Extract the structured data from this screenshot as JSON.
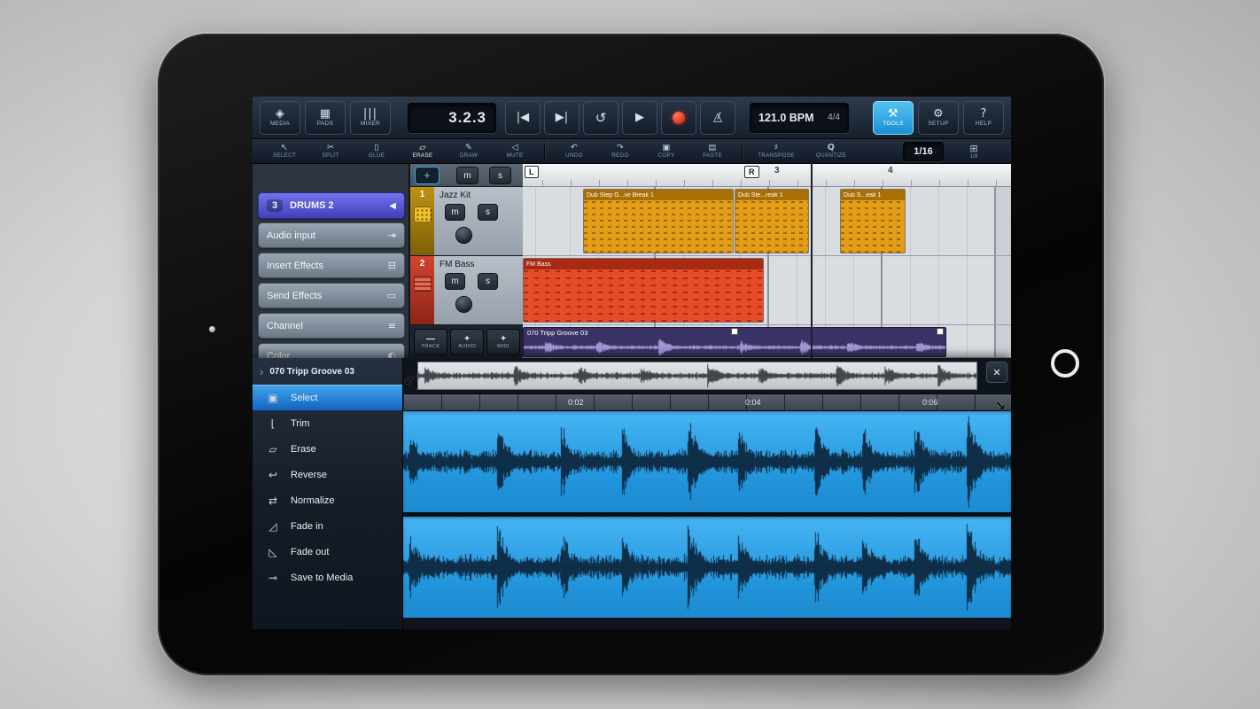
{
  "transport": {
    "media": "MEDIA",
    "pads": "PADS",
    "mixer": "MIXER",
    "time_display": "3.2.3",
    "bpm_display": "121.0 BPM",
    "time_signature": "4/4",
    "tools": "TOOLS",
    "setup": "SETUP",
    "help": "HELP"
  },
  "edit_bar": {
    "select": "SELECT",
    "split": "SPLIT",
    "glue": "GLUE",
    "erase": "ERASE",
    "draw": "DRAW",
    "mute": "MUTE",
    "undo": "UNDO",
    "redo": "REDO",
    "copy": "COPY",
    "paste": "PASTE",
    "transpose": "TRANSPOSE",
    "quantize": "QUANTIZE",
    "grid_value": "1/16",
    "snap_value": "1/8"
  },
  "inspector": {
    "track_number": "3",
    "track_name": "DRUMS 2",
    "items": [
      "Audio input",
      "Insert Effects",
      "Send Effects",
      "Channel",
      "Color"
    ]
  },
  "track_list": {
    "header_mute": "m",
    "header_solo": "s",
    "tracks": [
      {
        "number": "1",
        "name": "Jazz Kit",
        "mute": "m",
        "solo": "s"
      },
      {
        "number": "2",
        "name": "FM Bass",
        "mute": "m",
        "solo": "s"
      }
    ],
    "footer": {
      "track": "TRACK",
      "audio": "AUDIO",
      "midi": "MIDI"
    }
  },
  "arrangement": {
    "bar_3": "3",
    "bar_4": "4",
    "left_locator": "L",
    "right_locator": "R",
    "midi_clips": [
      "Dub Step G...ve Break 1",
      "Dub Ste...reak 1",
      "Dub S...eak 1"
    ],
    "bass_clip_name": "FM Bass",
    "audio_clip_name": "070 Tripp Groove 03"
  },
  "sample_editor": {
    "title": "070 Tripp Groove 03",
    "close": "✕",
    "tools": [
      "Select",
      "Trim",
      "Erase",
      "Reverse",
      "Normalize",
      "Fade in",
      "Fade out",
      "Save to Media"
    ],
    "times": [
      "0:02",
      "0:04",
      "0:06"
    ]
  },
  "colors": {
    "accent_blue": "#2da9e1",
    "record_red": "#d01808",
    "midi_clip_orange": "#e29e16",
    "bass_clip_red": "#e44c2a",
    "audio_clip_purple": "#3b3366",
    "wave_blue": "#2193da",
    "wave_dark": "#0e2940",
    "selected_row_blue": "#1264c0",
    "selected_track_purple": "#4140bc"
  }
}
